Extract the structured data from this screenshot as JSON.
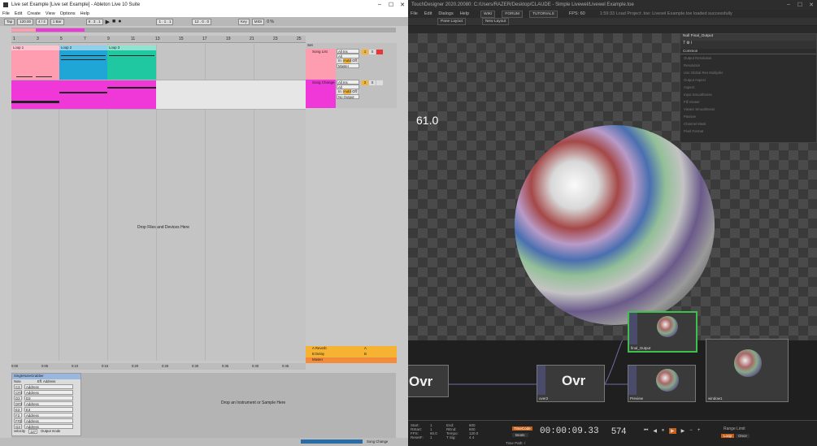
{
  "ableton": {
    "title": "Live set Example  [Live set Example] - Ableton Live 10 Suite",
    "menu": [
      "File",
      "Edit",
      "Create",
      "View",
      "Options",
      "Help"
    ],
    "control": {
      "tap": "Tap",
      "tempo": "120.00",
      "time_sig": "4 / 4",
      "quant": "1 Bar",
      "position": "8 . 3 . 1",
      "loop_start": "1 . 1 . 1",
      "loop_len": "12 . 0 . 0",
      "key": "Key",
      "midi": "MIDI",
      "cpu": "0 %"
    },
    "ruler": [
      "1",
      "3",
      "5",
      "7",
      "9",
      "11",
      "13",
      "15",
      "17",
      "19",
      "21",
      "23",
      "25"
    ],
    "clips": {
      "t1": [
        "Loop 1",
        "Loop 2",
        "Loop 3"
      ]
    },
    "tracks": [
      {
        "name": "Song List",
        "input": "All Ins",
        "channel": "All Channels",
        "mon": [
          "In",
          "Auto",
          "Off"
        ],
        "out": "Master",
        "num": "1",
        "s": "S",
        "color": "#ff9db0"
      },
      {
        "name": "Song Change",
        "input": "All Ins",
        "channel": "All Channels",
        "mon": [
          "In",
          "Auto",
          "Off"
        ],
        "out": "No Output",
        "num": "2",
        "s": "S",
        "color": "#f037d8"
      }
    ],
    "set_label": "Set",
    "drop_files": "Drop Files and Devices Here",
    "returns": [
      {
        "name": "A Reverb",
        "num": "A"
      },
      {
        "name": "B Delay",
        "num": "B"
      },
      {
        "name": "Master",
        "num": "1/2"
      }
    ],
    "time_ticks": [
      "0:00",
      "0:05",
      "0:10",
      "0:15",
      "0:20",
      "0:25",
      "0:30",
      "0:35",
      "0:40",
      "0:45"
    ],
    "device": {
      "name": "SingleNoteGrabber",
      "col1": "Note",
      "col2": "Eff. Address",
      "rows": [
        {
          "note": "C3",
          "addr": "Address"
        },
        {
          "note": "C#3",
          "addr": "Address"
        },
        {
          "note": "D3",
          "addr": "D3"
        },
        {
          "note": "D#3",
          "addr": "Address"
        },
        {
          "note": "E3",
          "addr": "E3"
        },
        {
          "note": "F3",
          "addr": "Address"
        },
        {
          "note": "F#3",
          "addr": "Address"
        },
        {
          "note": "G3",
          "addr": "Address"
        }
      ],
      "velocity": "velocity",
      "vel_val": "127",
      "output_mode": "Output mode"
    },
    "drop_instrument": "Drop an Instrument or Sample Here",
    "status_right": "Song Change"
  },
  "td": {
    "title": "TouchDesigner 2020.20080: C:/Users/RAZER/Desktop/CLAUDE - Simple Livewel/Livewel Example.toe",
    "menu": [
      "File",
      "Edit",
      "Dialogs",
      "Help"
    ],
    "menu_tabs": [
      "WIKI",
      "FORUM",
      "TUTORIALS"
    ],
    "fps_label": "FPS: 60",
    "status": "1:59:33 Load Project .toe: Livesel Example.toe loaded successfully",
    "pane_layout": "Pane Layout",
    "new_layout": "New Layout",
    "fps_overlay": "61.0",
    "params": {
      "header": "Null  Final_Output",
      "tab": "Common",
      "labels": [
        "Output Resolution",
        "Resolution",
        "Use Global Res Multiplier",
        "Output Aspect",
        "Aspect",
        "Input Smoothness",
        "Fill Viewer",
        "Viewer Smoothness",
        "Passive",
        "Channel Mask",
        "Pixel Format"
      ]
    },
    "nodes": {
      "final": "final_Output",
      "over2": "over2",
      "preview": "Preview",
      "window": "window1",
      "ovr_left": "Ovr",
      "ovr_mid": "Ovr"
    },
    "bottom": {
      "start": "Start:",
      "start_v": "1",
      "rstart": "RStart:",
      "rstart_v": "1",
      "fps": "FPS:",
      "fps_v": "60.0",
      "resetf": "ResetF:",
      "resetf_v": "1",
      "end": "End:",
      "end_v": "600",
      "rend": "REnd:",
      "rend_v": "600",
      "tempo": "Tempo:",
      "tempo_v": "120.0",
      "tsig": "T Sig:",
      "tsig_v": "4   4",
      "timecode_btn": "TimeCode",
      "beats_btn": "Beats",
      "timecode": "00:00:09.33",
      "frame": "574",
      "range_limit": "Range Limit",
      "loop": "Loop",
      "once": "Once",
      "timepath": "Time Path: /"
    }
  }
}
